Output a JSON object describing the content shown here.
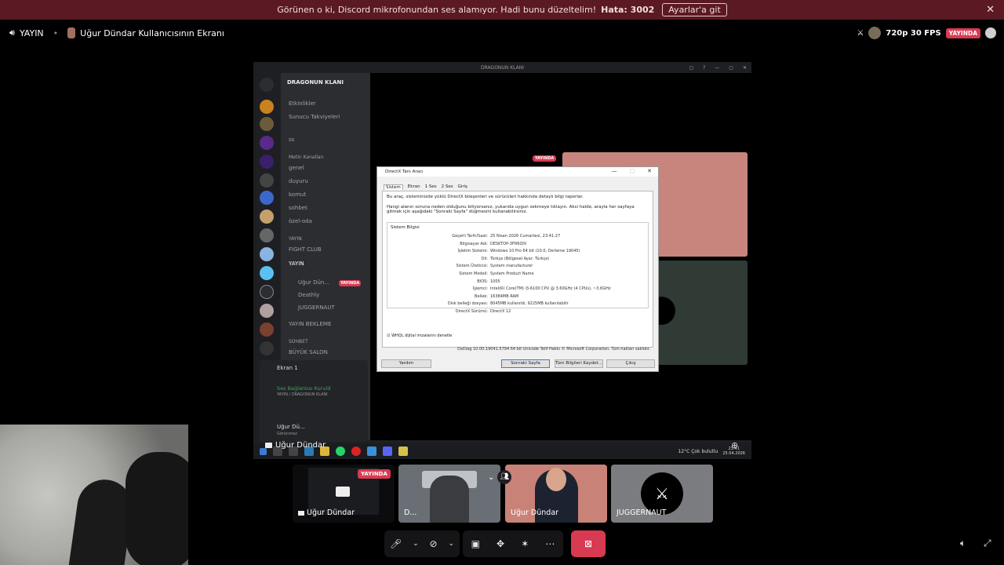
{
  "notice": {
    "message": "Görünen o ki, Discord mikrofonundan ses alamıyor. Hadi bunu düzeltelim!",
    "error_code": "Hata: 3002",
    "action_label": "Ayarlar'a git",
    "close_glyph": "✕"
  },
  "header": {
    "stream_label": "YAYIN",
    "title": "Uğur Dündar Kullanıcısının Ekranı",
    "quality": "720p 30 FPS",
    "live_badge": "YAYINDA"
  },
  "shared_screen": {
    "window_title": "DRAGONUN KLANI",
    "server_name": "DRAGONUN KLANI",
    "channels": [
      "Etkinlikler",
      "Sunucu Takviyeleri",
      "ss",
      "Metin Kanalları",
      "genel",
      "duyuru",
      "komut",
      "sohbet",
      "özel-oda",
      "YAYIN",
      "FIGHT CLUB",
      "YAYIN",
      "Uğur Dün...",
      "Deathly",
      "JUGGERNAUT",
      "YAYIN BEKLEME",
      "SOHBET",
      "BÜYÜK SALON"
    ],
    "voice_panel": {
      "screen_label": "Ekran 1",
      "voice_status": "Ses Bağlantısı Kuruld",
      "voice_channel": "YAYIN / DRAGONUN KLANI",
      "user_name": "Uğur Dü...",
      "user_status": "Görünmez"
    },
    "live_small": "YAYINDA",
    "taskbar": {
      "weather": "12°C  Çok bulutlu",
      "time": "23:41",
      "date": "25.04.2026"
    }
  },
  "dxdiag": {
    "title": "DirectX Tanı Aracı",
    "tabs": [
      "Sistem",
      "Ekran",
      "1 Ses",
      "2 Ses",
      "Giriş"
    ],
    "intro": "Bu araç, sisteminizde yüklü DirectX bileşenleri ve sürücüleri hakkında detaylı bilgi raporlar.",
    "help": "Hangi alanın soruna neden olduğunu biliyorsanız, yukarıda uygun sekmeye tıklayın. Aksi halde, arayla her sayfaya gitmek için aşağıdaki \"Sonraki Sayfa\" düğmesini kullanabilirsiniz.",
    "section": "Sistem Bilgisi",
    "rows": [
      {
        "k": "Geçerli Tarih/Saat:",
        "v": "25 Nisan 2026 Cumartesi, 23:41:27"
      },
      {
        "k": "Bilgisayar Adı:",
        "v": "DESKTOP-3FR6QIV"
      },
      {
        "k": "İşletim Sistemi:",
        "v": "Windows 10 Pro 64 bit (10.0, Derleme 19045)"
      },
      {
        "k": "Dil:",
        "v": "Türkçe (Bölgesel Ayar: Türkçe)"
      },
      {
        "k": "Sistem Üreticisi:",
        "v": "System manufacturer"
      },
      {
        "k": "Sistem Modeli:",
        "v": "System Product Name"
      },
      {
        "k": "BIOS:",
        "v": "1005"
      },
      {
        "k": "İşlemci:",
        "v": "Intel(R) Core(TM) i3-6100 CPU @ 3.60GHz (4 CPUs), ~3.6GHz"
      },
      {
        "k": "Bellek:",
        "v": "16384MB RAM"
      },
      {
        "k": "Disk belleği dosyası:",
        "v": "8045MB kullanıldı, 9225MB kullanılabilir"
      },
      {
        "k": "DirectX Sürümü:",
        "v": "DirectX 12"
      }
    ],
    "whql": "WHQL dijital imzalarını denetle",
    "copyright": "DxDiag 10.00.19041.5794 64 bit Unicode  Telif Hakkı © Microsoft Corporation. Tüm hakları saklıdır.",
    "buttons": {
      "help": "Yardım",
      "next": "Sonraki Sayfa",
      "save": "Tüm Bilgileri Kaydet...",
      "exit": "Çıkış"
    }
  },
  "self_view": {
    "name": "Uğur Dündar"
  },
  "participants": [
    {
      "name": "Uğur Dündar",
      "badge": "YAYINDA"
    },
    {
      "name": "D..."
    },
    {
      "name": "Uğur Dündar"
    },
    {
      "name": "JUGGERNAUT"
    }
  ],
  "colors": {
    "notice_bg": "#5a1923",
    "live_red": "#d83a52",
    "leave_red": "#d83a52"
  }
}
